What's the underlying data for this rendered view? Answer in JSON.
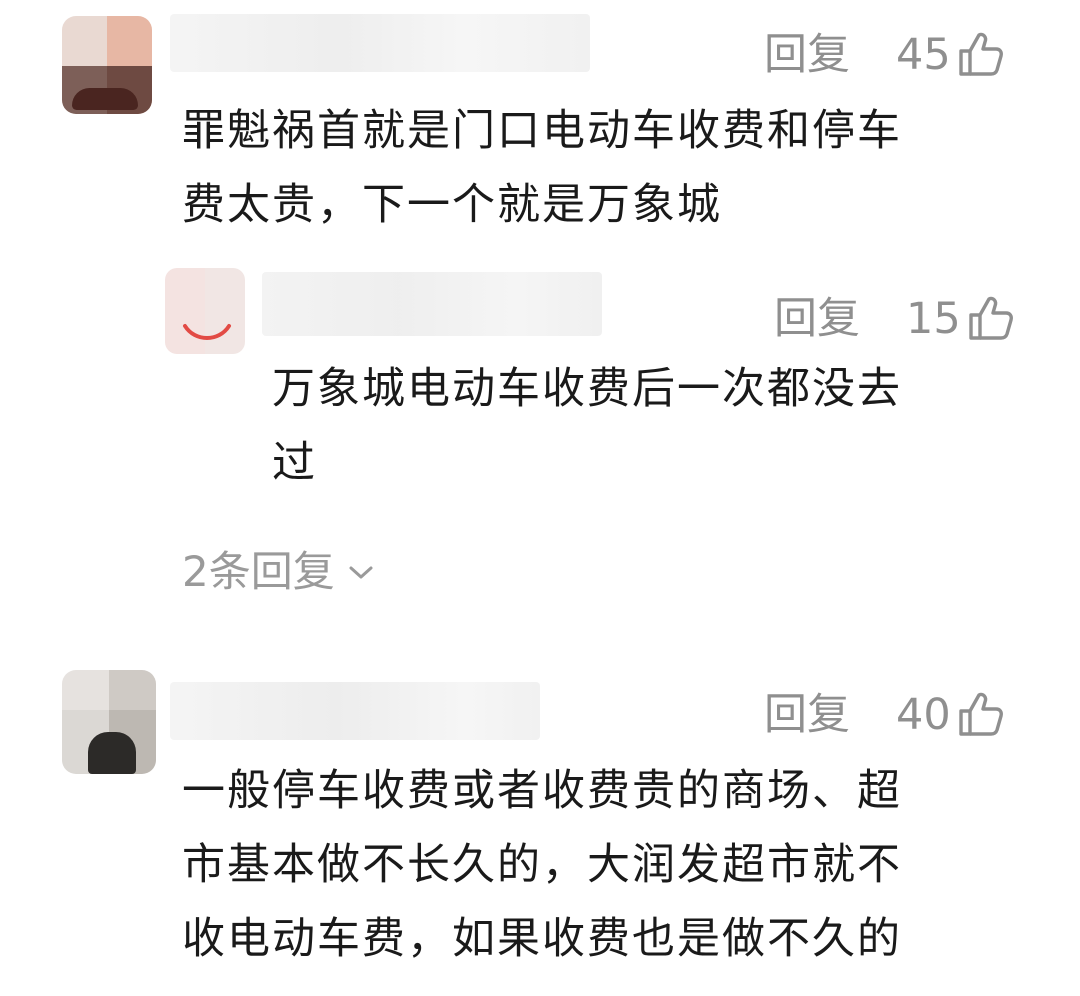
{
  "comments": [
    {
      "avatar": "user-avatar",
      "reply_label": "回复",
      "likes": "45",
      "icon": "thumbs-up-icon",
      "line1": "罪魁祸首就是门口电动车收费和停车",
      "line2": "费太贵，下一个就是万象城"
    },
    {
      "avatar": "user-avatar",
      "reply_label": "回复",
      "likes": "15",
      "icon": "thumbs-up-icon",
      "line1": "万象城电动车收费后一次都没去",
      "line2": "过"
    },
    {
      "avatar": "user-avatar",
      "reply_label": "回复",
      "likes": "40",
      "icon": "thumbs-up-icon",
      "line1": "一般停车收费或者收费贵的商场、超",
      "line2": "市基本做不长久的，大润发超市就不",
      "line3": "收电动车费，如果收费也是做不久的"
    }
  ],
  "more_replies": {
    "label": "2条回复",
    "icon": "chevron-down-icon"
  },
  "colors": {
    "text": "#1a1a1a",
    "meta": "#8f8f8f",
    "background": "#ffffff"
  }
}
